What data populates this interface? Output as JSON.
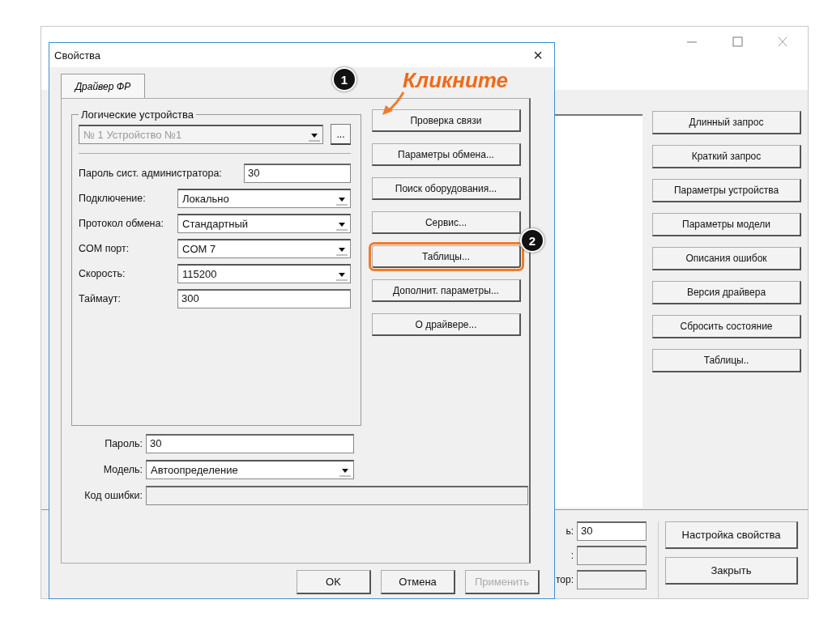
{
  "main_window": {
    "buttons": [
      {
        "label": "Длинный запрос"
      },
      {
        "label": "Краткий запрос"
      },
      {
        "label": "Параметры устройства"
      },
      {
        "label": "Параметры модели"
      },
      {
        "label": "Описания ошибок"
      },
      {
        "label": "Версия драйвера"
      },
      {
        "label": "Сбросить состояние"
      },
      {
        "label": "Таблицы.."
      }
    ],
    "bottom_fields": [
      {
        "label": "ь:",
        "value": "30"
      },
      {
        "label": ":"
      },
      {
        "label": "тор:"
      }
    ],
    "bottom_buttons": [
      {
        "label": "Настройка свойства"
      },
      {
        "label": "Закрыть"
      }
    ]
  },
  "dialog": {
    "title": "Свойства",
    "close": "×",
    "tabs": [
      {
        "label": "Драйвер ФР",
        "selected": true
      }
    ],
    "group_title": "Логические устройства",
    "device": {
      "value": "№ 1 Устройство №1",
      "disabled": true
    },
    "device_button": "...",
    "fields": [
      {
        "label": "Пароль сист. администратора:",
        "kind": "input",
        "value": "30"
      },
      {
        "label": "Подключение:",
        "kind": "combo",
        "value": "Локально"
      },
      {
        "label": "Протокол обмена:",
        "kind": "combo",
        "value": "Стандартный"
      },
      {
        "label": "COM порт:",
        "kind": "combo",
        "value": "COM 7"
      },
      {
        "label": "Скорость:",
        "kind": "combo",
        "value": "115200"
      },
      {
        "label": "Таймаут:",
        "kind": "input",
        "value": "300"
      }
    ],
    "action_buttons": [
      {
        "label": "Проверка связи",
        "highlighted": false
      },
      {
        "label": "Параметры обмена...",
        "highlighted": false
      },
      {
        "label": "Поиск оборудования...",
        "highlighted": false
      },
      {
        "label": "Сервис...",
        "highlighted": false
      },
      {
        "label": "Таблицы...",
        "highlighted": true
      },
      {
        "label": "Дополнит. параметры...",
        "highlighted": false
      },
      {
        "label": "О драйвере...",
        "highlighted": false
      }
    ],
    "bottom_fields": [
      {
        "label": "Пароль:",
        "kind": "input",
        "value": "30"
      },
      {
        "label": "Модель:",
        "kind": "combo",
        "value": "Автоопределение"
      },
      {
        "label": "Код ошибки:",
        "kind": "readonly"
      }
    ],
    "footer_buttons": [
      {
        "label": "OK",
        "disabled": false
      },
      {
        "label": "Отмена",
        "disabled": false
      },
      {
        "label": "Применить",
        "disabled": true
      }
    ]
  },
  "annotations": {
    "badges": [
      "1",
      "2"
    ],
    "callout": "Кликните"
  }
}
